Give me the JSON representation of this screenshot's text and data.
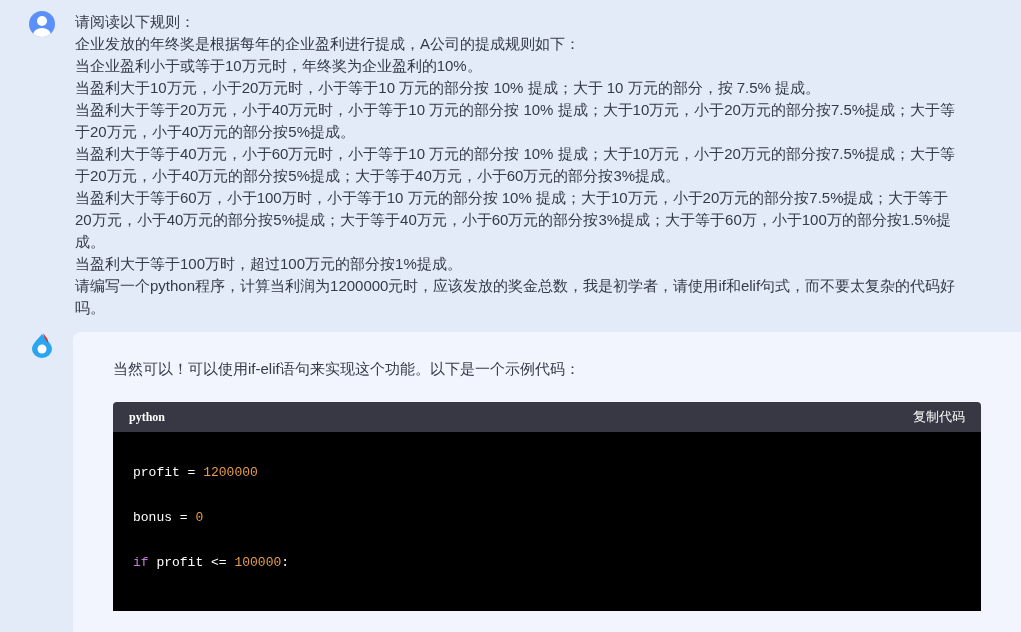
{
  "user_message": {
    "lines": [
      "请阅读以下规则：",
      "企业发放的年终奖是根据每年的企业盈利进行提成，A公司的提成规则如下：",
      "当企业盈利小于或等于10万元时，年终奖为企业盈利的10%。",
      "当盈利大于10万元，小于20万元时，小于等于10 万元的部分按 10% 提成；大于 10 万元的部分，按 7.5% 提成。",
      "当盈利大于等于20万元，小于40万元时，小于等于10 万元的部分按 10% 提成；大于10万元，小于20万元的部分按7.5%提成；大于等于20万元，小于40万元的部分按5%提成。",
      "当盈利大于等于40万元，小于60万元时，小于等于10 万元的部分按 10% 提成；大于10万元，小于20万元的部分按7.5%提成；大于等于20万元，小于40万元的部分按5%提成；大于等于40万元，小于60万元的部分按3%提成。",
      "当盈利大于等于60万，小于100万时，小于等于10 万元的部分按 10% 提成；大于10万元，小于20万元的部分按7.5%提成；大于等于20万元，小于40万元的部分按5%提成；大于等于40万元，小于60万元的部分按3%提成；大于等于60万，小于100万的部分按1.5%提成。",
      "当盈利大于等于100万时，超过100万元的部分按1%提成。",
      "请编写一个python程序，计算当利润为1200000元时，应该发放的奖金总数，我是初学者，请使用if和elif句式，而不要太复杂的代码好吗。"
    ]
  },
  "assistant_message": {
    "intro": "当然可以！可以使用if-elif语句来实现这个功能。以下是一个示例代码：",
    "code_block": {
      "language": "python",
      "copy_button": "复制代码",
      "lines": [
        [
          {
            "kind": "plain",
            "text": "profit = "
          },
          {
            "kind": "number",
            "text": "1200000"
          }
        ],
        [
          {
            "kind": "plain",
            "text": "bonus = "
          },
          {
            "kind": "number",
            "text": "0"
          }
        ],
        [
          {
            "kind": "keyword",
            "text": "if"
          },
          {
            "kind": "plain",
            "text": " profit <= "
          },
          {
            "kind": "number",
            "text": "100000"
          },
          {
            "kind": "plain",
            "text": ":"
          }
        ]
      ]
    }
  }
}
